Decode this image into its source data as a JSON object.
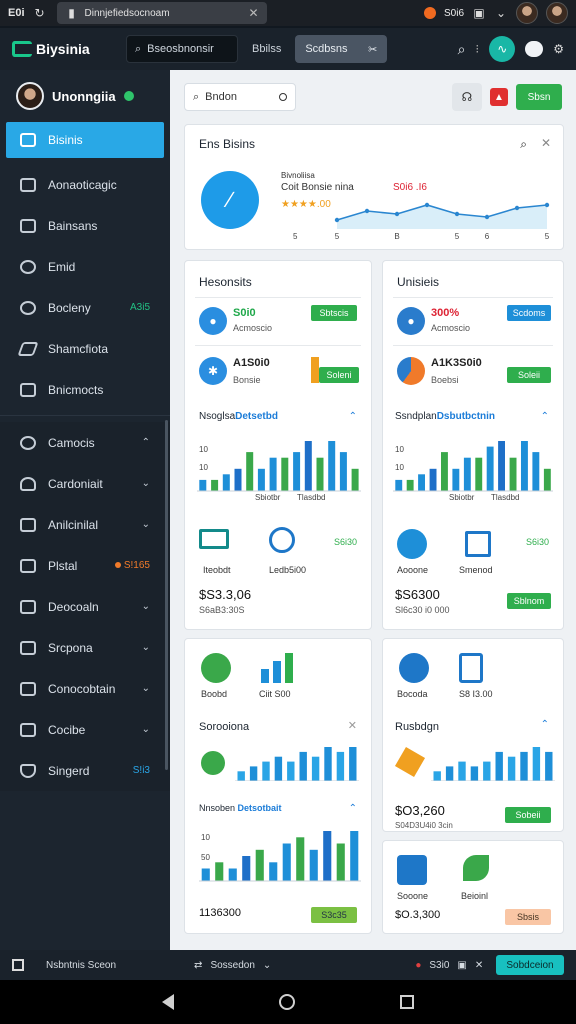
{
  "status": {
    "time": "E0i",
    "url": "Dinnjefiedsocnoam",
    "right_label": "S0i6"
  },
  "header": {
    "app_name": "Biysinia",
    "search_text": "Bseosbnonsir",
    "tab_label": "Bbilss",
    "pill_label": "Scdbsns"
  },
  "sidebar": {
    "user_name": "Unonngiia",
    "items": [
      {
        "label": "Bisinis",
        "active": true
      },
      {
        "label": "Aonaoticagic"
      },
      {
        "label": "Bainsans"
      },
      {
        "label": "Emid"
      },
      {
        "label": "Bocleny",
        "badge": "A3i5"
      },
      {
        "label": "Shamcfiota"
      },
      {
        "label": "Bnicmocts"
      },
      {
        "label": "Camocis"
      },
      {
        "label": "Cardoniait"
      },
      {
        "label": "Anilcinilal"
      },
      {
        "label": "Plstal",
        "badge": "S!165"
      },
      {
        "label": "Deocoaln"
      },
      {
        "label": "Srcpona"
      },
      {
        "label": "Conocobtain"
      },
      {
        "label": "Cocibe"
      },
      {
        "label": "Singerd",
        "badge": "S!i3"
      }
    ]
  },
  "toolbar": {
    "search_text": "Bndon",
    "action_label": "Sbsn"
  },
  "overview": {
    "title": "Ens Bisins",
    "small_title": "Bivnoliisa",
    "line_label": "Coit Bonsie nina",
    "price": "S0i6 .I6",
    "rating_text": "★★★★.00",
    "chart_data": {
      "type": "line",
      "categories": [
        "5",
        "",
        "B",
        "",
        "5",
        "6",
        "",
        "5"
      ],
      "series": [
        {
          "values": [
            3,
            6,
            5,
            8,
            5,
            4,
            7,
            8
          ]
        }
      ]
    }
  },
  "left_card": {
    "title": "Hesonsits",
    "kpi1": {
      "value": "S0i0",
      "sub": "Acmoscio",
      "tag": "Sbtscis"
    },
    "kpi2": {
      "value": "A1S0i0",
      "sub": "Bonsie",
      "tag": "Soleni"
    },
    "section_title": "Nsoglsa",
    "section_highlight": "Detsetbd",
    "axis": [
      "10",
      "10"
    ],
    "x_labels": [
      "Sbiotbr",
      "Tlasdbd"
    ],
    "chart_data": {
      "type": "bar",
      "series": [
        {
          "name": "",
          "values": [
            2,
            2,
            3,
            4,
            7,
            4,
            6,
            6,
            7,
            9,
            6,
            9,
            7,
            4
          ]
        }
      ]
    },
    "icon_labels": [
      "Iteobdt",
      "Ledb5i00"
    ],
    "side_value": "S6i30",
    "amount": "$S3.3,06",
    "amount_sub": "S6aB3:30S"
  },
  "right_card": {
    "title": "Unisieis",
    "kpi1": {
      "value": "300%",
      "sub": "Acmoscio",
      "tag": "Scdoms"
    },
    "kpi2": {
      "value": "A1K3S0i0",
      "sub": "Boebsi",
      "tag": "Soleii"
    },
    "section_title": "Ssndplan",
    "section_highlight": "Dsbutbctnin",
    "axis": [
      "10",
      "10"
    ],
    "x_labels": [
      "Sbiotbr",
      "Tlasdbd"
    ],
    "chart_data": {
      "type": "bar",
      "series": [
        {
          "name": "",
          "values": [
            2,
            2,
            3,
            4,
            7,
            4,
            6,
            6,
            8,
            9,
            6,
            9,
            7,
            4
          ]
        }
      ]
    },
    "icon_labels": [
      "Aooone",
      "Smenod"
    ],
    "side_value": "S6i30",
    "amount": "$S6300",
    "amount_sub": "Sl6c30 i0 000",
    "tag": "Sblnom"
  },
  "lower_left": {
    "icon_labels": [
      "Boobd",
      "Ciit S00"
    ],
    "section1": "Sorooiona",
    "chart1": {
      "type": "bar",
      "values": [
        2,
        3,
        4,
        5,
        4,
        6,
        5,
        7,
        6,
        7
      ]
    },
    "section2": "Nnsoben",
    "section2_highlight": "Detsotbait",
    "axis": [
      "10",
      "50"
    ],
    "chart2": {
      "type": "bar",
      "values": [
        2,
        3,
        2,
        4,
        5,
        3,
        6,
        7,
        5,
        8,
        6,
        8
      ]
    },
    "amount": "1136300",
    "tag": "S3c35"
  },
  "lower_right": {
    "icon_labels": [
      "Bocoda",
      "S8 I3.00"
    ],
    "section1": "Rusbdgn",
    "chart1": {
      "type": "bar",
      "values": [
        2,
        3,
        4,
        3,
        4,
        6,
        5,
        6,
        7,
        6
      ]
    },
    "amount": "$O3,260",
    "amount_sub": "S04D3U4i0 3cin",
    "tag1": "Sobeii",
    "icon_labels2": [
      "Sooone",
      "Beioinl"
    ],
    "amount2": "$O.3,300",
    "tag2": "Sbsis"
  },
  "bottombar": {
    "left_label": "Nsbntnis Sceon",
    "mid_label": "Sossedon",
    "right_label": "S3i0",
    "button_label": "Sobdceion"
  },
  "colors": {
    "accent": "#29a8e6",
    "green": "#2fae4d",
    "orange": "#f07a2a",
    "teal": "#18c0c0"
  }
}
